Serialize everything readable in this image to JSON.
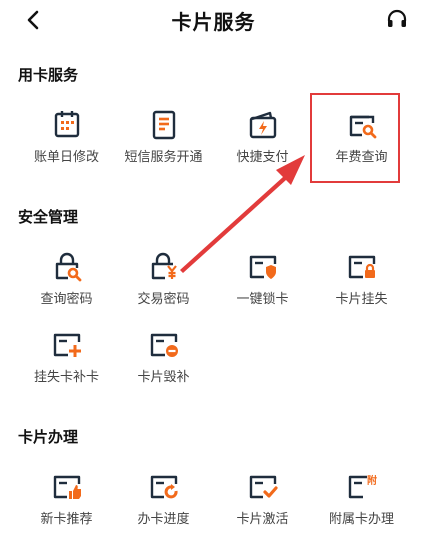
{
  "header": {
    "title": "卡片服务",
    "back_icon": "chevron-left-icon",
    "support_icon": "headset-icon"
  },
  "colors": {
    "icon_dark": "#1f2d3d",
    "icon_accent": "#f26a1b",
    "highlight": "#e23b3b"
  },
  "sections": [
    {
      "title": "用卡服务",
      "items": [
        {
          "label": "账单日修改",
          "icon": "calendar-icon"
        },
        {
          "label": "短信服务开通",
          "icon": "sms-document-icon"
        },
        {
          "label": "快捷支付",
          "icon": "quick-pay-wallet-icon"
        },
        {
          "label": "年费查询",
          "icon": "annual-fee-search-icon"
        }
      ]
    },
    {
      "title": "安全管理",
      "items": [
        {
          "label": "查询密码",
          "icon": "lock-search-icon"
        },
        {
          "label": "交易密码",
          "icon": "lock-yen-icon"
        },
        {
          "label": "一键锁卡",
          "icon": "card-shield-icon"
        },
        {
          "label": "卡片挂失",
          "icon": "card-lock-icon"
        },
        {
          "label": "挂失卡补卡",
          "icon": "card-add-icon"
        },
        {
          "label": "卡片毁补",
          "icon": "card-minus-icon"
        }
      ]
    },
    {
      "title": "卡片办理",
      "items": [
        {
          "label": "新卡推荐",
          "icon": "card-thumbs-up-icon"
        },
        {
          "label": "办卡进度",
          "icon": "card-progress-icon"
        },
        {
          "label": "卡片激活",
          "icon": "card-check-icon"
        },
        {
          "label": "附属卡办理",
          "icon": "card-supplementary-icon",
          "badge": "附"
        }
      ]
    }
  ]
}
